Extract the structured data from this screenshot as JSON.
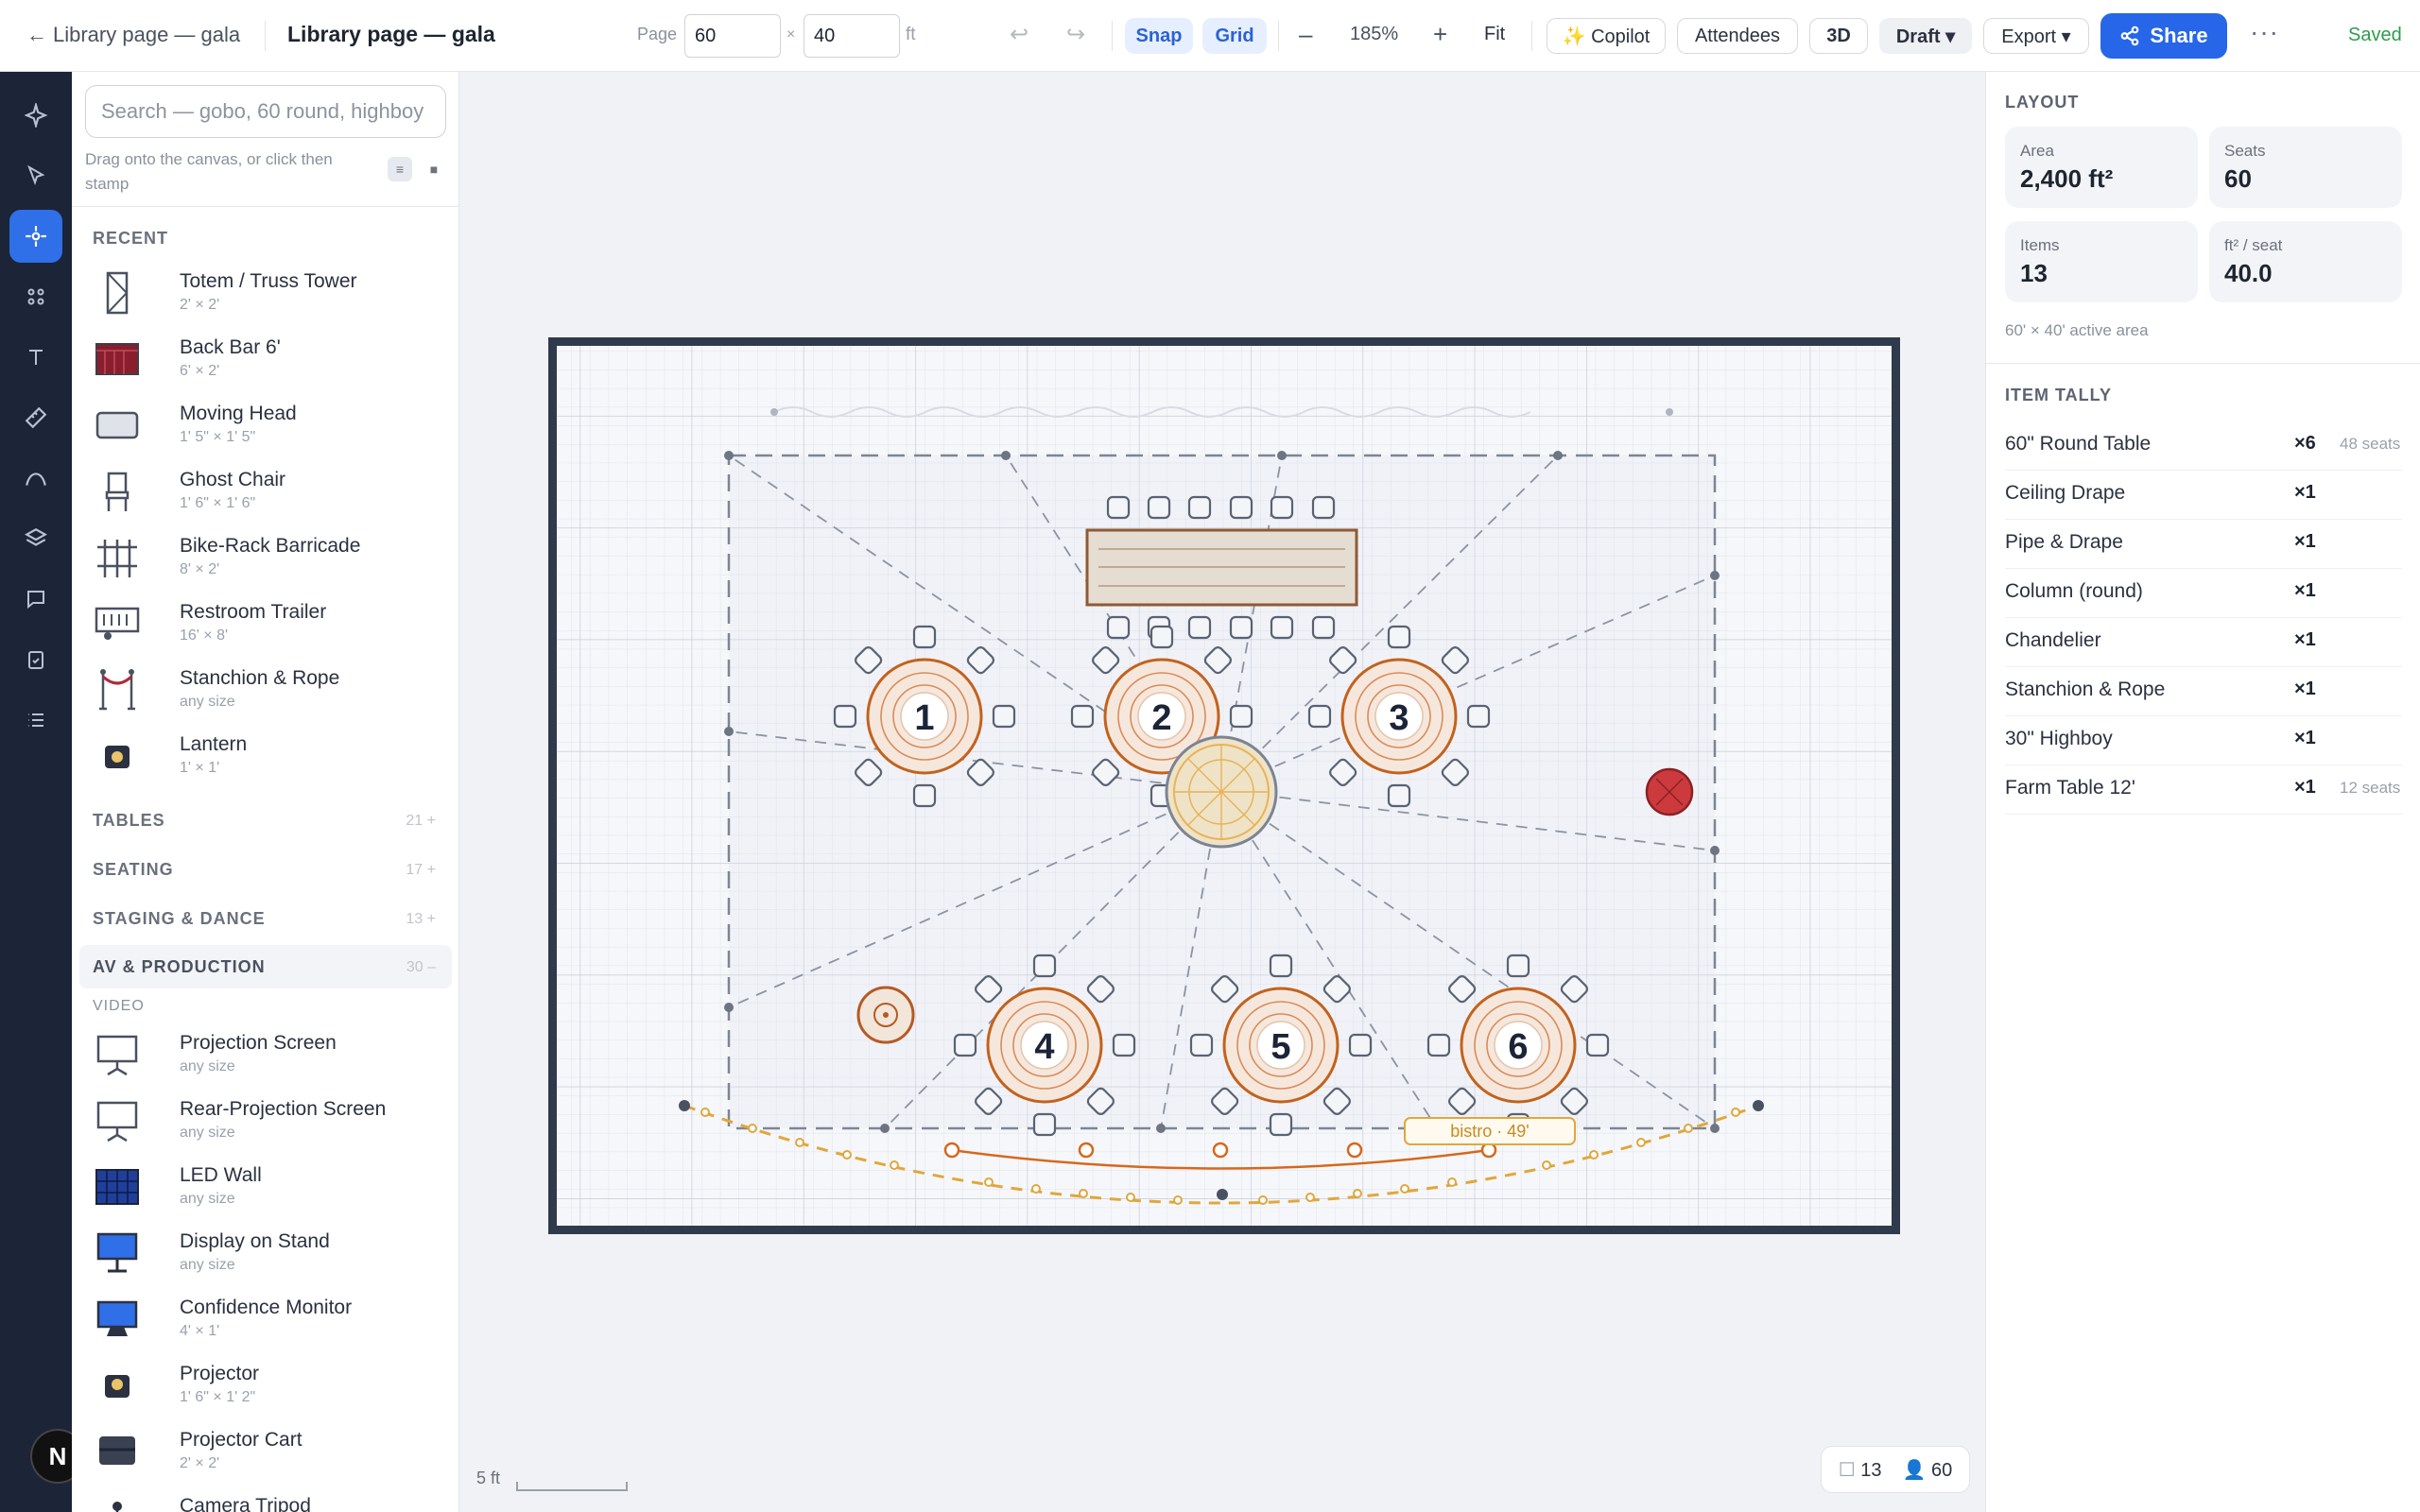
{
  "topbar": {
    "back_label": "Library page — gala",
    "title": "Library page — gala",
    "page_label": "Page",
    "width_value": "60",
    "times": "×",
    "height_value": "40",
    "unit": "ft",
    "snap": "Snap",
    "grid": "Grid",
    "zoom_out": "–",
    "zoom": "185%",
    "zoom_in": "+",
    "fit": "Fit",
    "copilot": "✨ Copilot",
    "attendees": "Attendees",
    "three_d": "3D",
    "draft": "Draft ▾",
    "export": "Export ▾",
    "share": "Share",
    "more": "···",
    "saved": "Saved"
  },
  "library": {
    "search_placeholder": "Search — gobo, 60 round, highboy",
    "hint": "Drag onto the canvas, or click then stamp",
    "recent_title": "RECENT",
    "recent": [
      {
        "name": "Totem / Truss Tower",
        "dim": "2' × 2'",
        "icon": "truss-tower-icon"
      },
      {
        "name": "Back Bar 6'",
        "dim": "6' × 2'",
        "icon": "back-bar-icon"
      },
      {
        "name": "Moving Head",
        "dim": "1' 5\" × 1' 5\"",
        "icon": "moving-head-icon"
      },
      {
        "name": "Ghost Chair",
        "dim": "1' 6\" × 1' 6\"",
        "icon": "ghost-chair-icon"
      },
      {
        "name": "Bike-Rack Barricade",
        "dim": "8' × 2'",
        "icon": "barricade-icon"
      },
      {
        "name": "Restroom Trailer",
        "dim": "16' × 8'",
        "icon": "restroom-trailer-icon"
      },
      {
        "name": "Stanchion & Rope",
        "dim": "any size",
        "icon": "stanchion-icon"
      },
      {
        "name": "Lantern",
        "dim": "1' × 1'",
        "icon": "lantern-icon"
      }
    ],
    "sections": [
      {
        "name": "TABLES",
        "count": "21 +"
      },
      {
        "name": "SEATING",
        "count": "17 +"
      },
      {
        "name": "STAGING & DANCE",
        "count": "13 +"
      },
      {
        "name": "AV & PRODUCTION",
        "count": "30 –"
      }
    ],
    "video_title": "VIDEO",
    "video": [
      {
        "name": "Projection Screen",
        "dim": "any size",
        "icon": "projection-screen-icon"
      },
      {
        "name": "Rear-Projection Screen",
        "dim": "any size",
        "icon": "rear-projection-icon"
      },
      {
        "name": "LED Wall",
        "dim": "any size",
        "icon": "led-wall-icon"
      },
      {
        "name": "Display on Stand",
        "dim": "any size",
        "icon": "display-stand-icon"
      },
      {
        "name": "Confidence Monitor",
        "dim": "4' × 1'",
        "icon": "confidence-monitor-icon"
      },
      {
        "name": "Projector",
        "dim": "1' 6\" × 1' 2\"",
        "icon": "projector-icon"
      },
      {
        "name": "Projector Cart",
        "dim": "2' × 2'",
        "icon": "projector-cart-icon"
      },
      {
        "name": "Camera Tripod",
        "dim": "",
        "icon": "camera-tripod-icon"
      }
    ]
  },
  "canvas": {
    "tables": [
      "1",
      "2",
      "3",
      "4",
      "5",
      "6"
    ],
    "bistro_label": "bistro · 49'",
    "scale_label": "5 ft",
    "count_items": "13",
    "count_people": "60"
  },
  "layout": {
    "title": "LAYOUT",
    "stats": [
      {
        "label": "Area",
        "value": "2,400 ft²"
      },
      {
        "label": "Seats",
        "value": "60"
      },
      {
        "label": "Items",
        "value": "13"
      },
      {
        "label": "ft² / seat",
        "value": "40.0"
      }
    ],
    "note": "60' × 40' active area"
  },
  "tally": {
    "title": "ITEM TALLY",
    "rows": [
      {
        "name": "60\" Round Table",
        "count": "×6",
        "extra": "48 seats"
      },
      {
        "name": "Ceiling Drape",
        "count": "×1",
        "extra": ""
      },
      {
        "name": "Pipe & Drape",
        "count": "×1",
        "extra": ""
      },
      {
        "name": "Column (round)",
        "count": "×1",
        "extra": ""
      },
      {
        "name": "Chandelier",
        "count": "×1",
        "extra": ""
      },
      {
        "name": "Stanchion & Rope",
        "count": "×1",
        "extra": ""
      },
      {
        "name": "30\" Highboy",
        "count": "×1",
        "extra": ""
      },
      {
        "name": "Farm Table 12'",
        "count": "×1",
        "extra": "12 seats"
      }
    ]
  },
  "colors": {
    "accent": "#2766e8",
    "rail": "#1c2437",
    "table_ring": "#c2621d",
    "bistro": "#e0a73c",
    "saved": "#2e9b4e"
  }
}
